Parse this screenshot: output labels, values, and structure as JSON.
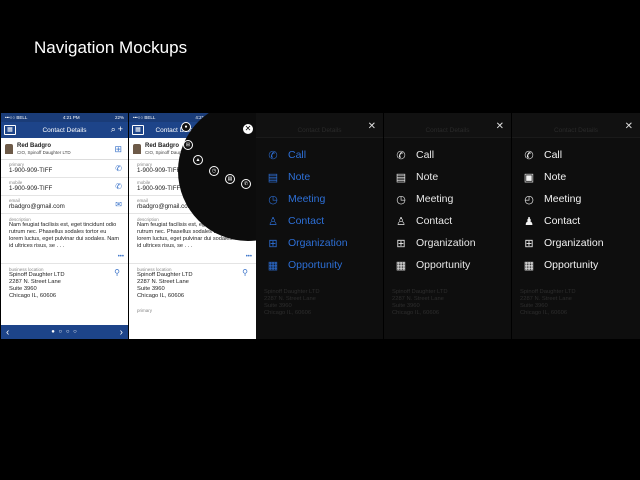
{
  "slide_title": "Navigation Mockups",
  "phone": {
    "carrier": "•••○○ BELL",
    "time": "4:21 PM",
    "battery": "22%",
    "nav_title": "Contact Details",
    "contact_name": "Red Badgro",
    "contact_sub": "CIO, Spinoff Daughter LTD",
    "fields": [
      {
        "label": "primary",
        "value": "1-900-909-TIFF"
      },
      {
        "label": "mobile",
        "value": "1-900-909-TIFF"
      },
      {
        "label": "email",
        "value": "rbadgro@gmail.com"
      }
    ],
    "description_label": "description",
    "description": "Nam feugiat facilisis est, eget tincidunt odio rutrum nec. Phasellus sodales tortor eu lorem luctus, eget pulvinar dui sodales. Nam id ultrices risus, se . . .",
    "more": "•••",
    "address_label": "business location",
    "address_lines": [
      "Spinoff Daughter LTD",
      "2287 N. Street Lane",
      "Suite 3960",
      "Chicago IL, 60606"
    ],
    "primary_label": "primary"
  },
  "menu_items": [
    "Call",
    "Note",
    "Meeting",
    "Contact",
    "Organization",
    "Opportunity"
  ],
  "icons": {
    "call": "phone-icon",
    "note": "note-icon",
    "meeting": "clock-icon",
    "contact": "person-icon",
    "organization": "org-chart-icon",
    "opportunity": "chart-icon"
  },
  "colors": {
    "nav_blue": "#1d4489",
    "accent_blue": "#2d6fd6",
    "background": "#000000"
  }
}
